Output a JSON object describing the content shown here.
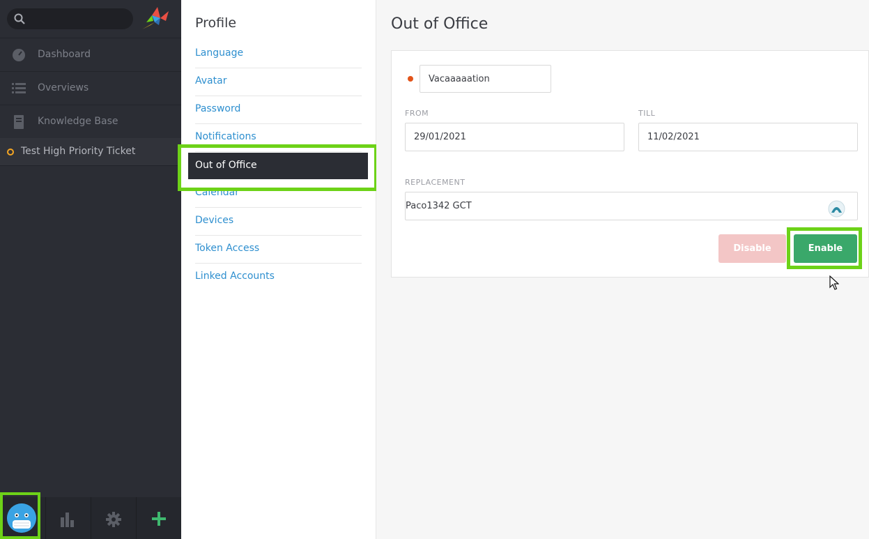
{
  "search": {
    "placeholder": ""
  },
  "nav": {
    "items": [
      {
        "label": "Dashboard",
        "icon": "dashboard-icon"
      },
      {
        "label": "Overviews",
        "icon": "list-icon"
      },
      {
        "label": "Knowledge Base",
        "icon": "book-icon"
      }
    ],
    "open_ticket": "Test High Priority Ticket"
  },
  "profile": {
    "title": "Profile",
    "links": [
      "Language",
      "Avatar",
      "Password",
      "Notifications",
      "Out of Office",
      "Calendar",
      "Devices",
      "Token Access",
      "Linked Accounts"
    ],
    "active": "Out of Office"
  },
  "main": {
    "title": "Out of Office",
    "message_value": "Vacaaaaation",
    "from_label": "FROM",
    "from_value": "29/01/2021",
    "till_label": "TILL",
    "till_value": "11/02/2021",
    "replacement_label": "REPLACEMENT",
    "replacement_value": "Paco1342 GCT",
    "disable_label": "Disable",
    "enable_label": "Enable"
  },
  "colors": {
    "accent": "#6dd218",
    "link": "#2e8fcf",
    "enable": "#3aa86a",
    "disable": "#f3c6c6",
    "required": "#e2541a",
    "ticket_status": "#f5a623"
  }
}
